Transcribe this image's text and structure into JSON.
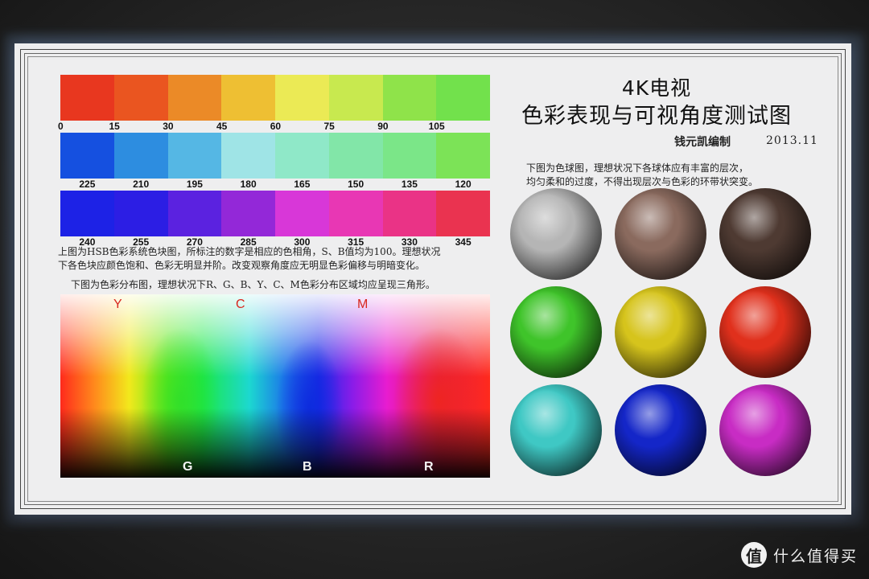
{
  "hue_strips": [
    {
      "labels": [
        "0",
        "15",
        "30",
        "45",
        "60",
        "75",
        "90",
        "105"
      ],
      "colors": [
        "#e8371f",
        "#ea5520",
        "#eb8a27",
        "#eebf33",
        "#ebea55",
        "#c8e94f",
        "#8fe34a",
        "#72e14c"
      ]
    },
    {
      "labels": [
        "225",
        "210",
        "195",
        "180",
        "165",
        "150",
        "135",
        "120"
      ],
      "colors": [
        "#1550e0",
        "#2d8de0",
        "#55b7e4",
        "#9fe4e6",
        "#8fe8c8",
        "#82e6a8",
        "#7be688",
        "#7ce357"
      ]
    },
    {
      "labels": [
        "240",
        "255",
        "270",
        "285",
        "300",
        "315",
        "330",
        "345"
      ],
      "colors": [
        "#1d22e6",
        "#2c1ee4",
        "#5b22e0",
        "#9328d8",
        "#d837d8",
        "#e837b4",
        "#ea3386",
        "#ea3350"
      ]
    }
  ],
  "notes": {
    "hsb_line1": "上图为HSB色彩系统色块图，所标注的数字是相应的色相角，S、B值均为100。理想状况",
    "hsb_line2": "下各色块应颜色饱和、色彩无明显并阶。改变观察角度应无明显色彩偏移与明暗变化。",
    "gamut_note": "下图为色彩分布图，理想状况下R、G、B、Y、C、M色彩分布区域均应呈现三角形。",
    "sphere_note_line1": "下图为色球图，理想状况下各球体应有丰富的层次，",
    "sphere_note_line2": "均匀柔和的过度，不得出现层次与色彩的环带状突变。"
  },
  "gamut": {
    "top_labels": [
      "Y",
      "C",
      "M"
    ],
    "bottom_labels": [
      "G",
      "B",
      "R"
    ]
  },
  "title": {
    "line1": "4K电视",
    "line2": "色彩表现与可视角度测试图"
  },
  "author": "钱元凯编制",
  "date": "2013.11",
  "spheres": [
    {
      "color": "#b5b5b5"
    },
    {
      "color": "#8a6a5e"
    },
    {
      "color": "#4e3a32"
    },
    {
      "color": "#3fc42a"
    },
    {
      "color": "#d6c41c"
    },
    {
      "color": "#e0301c"
    },
    {
      "color": "#3fc8c4"
    },
    {
      "color": "#1426c8"
    },
    {
      "color": "#c82cc4"
    }
  ],
  "watermark": {
    "logo_char": "值",
    "text": "什么值得买"
  }
}
